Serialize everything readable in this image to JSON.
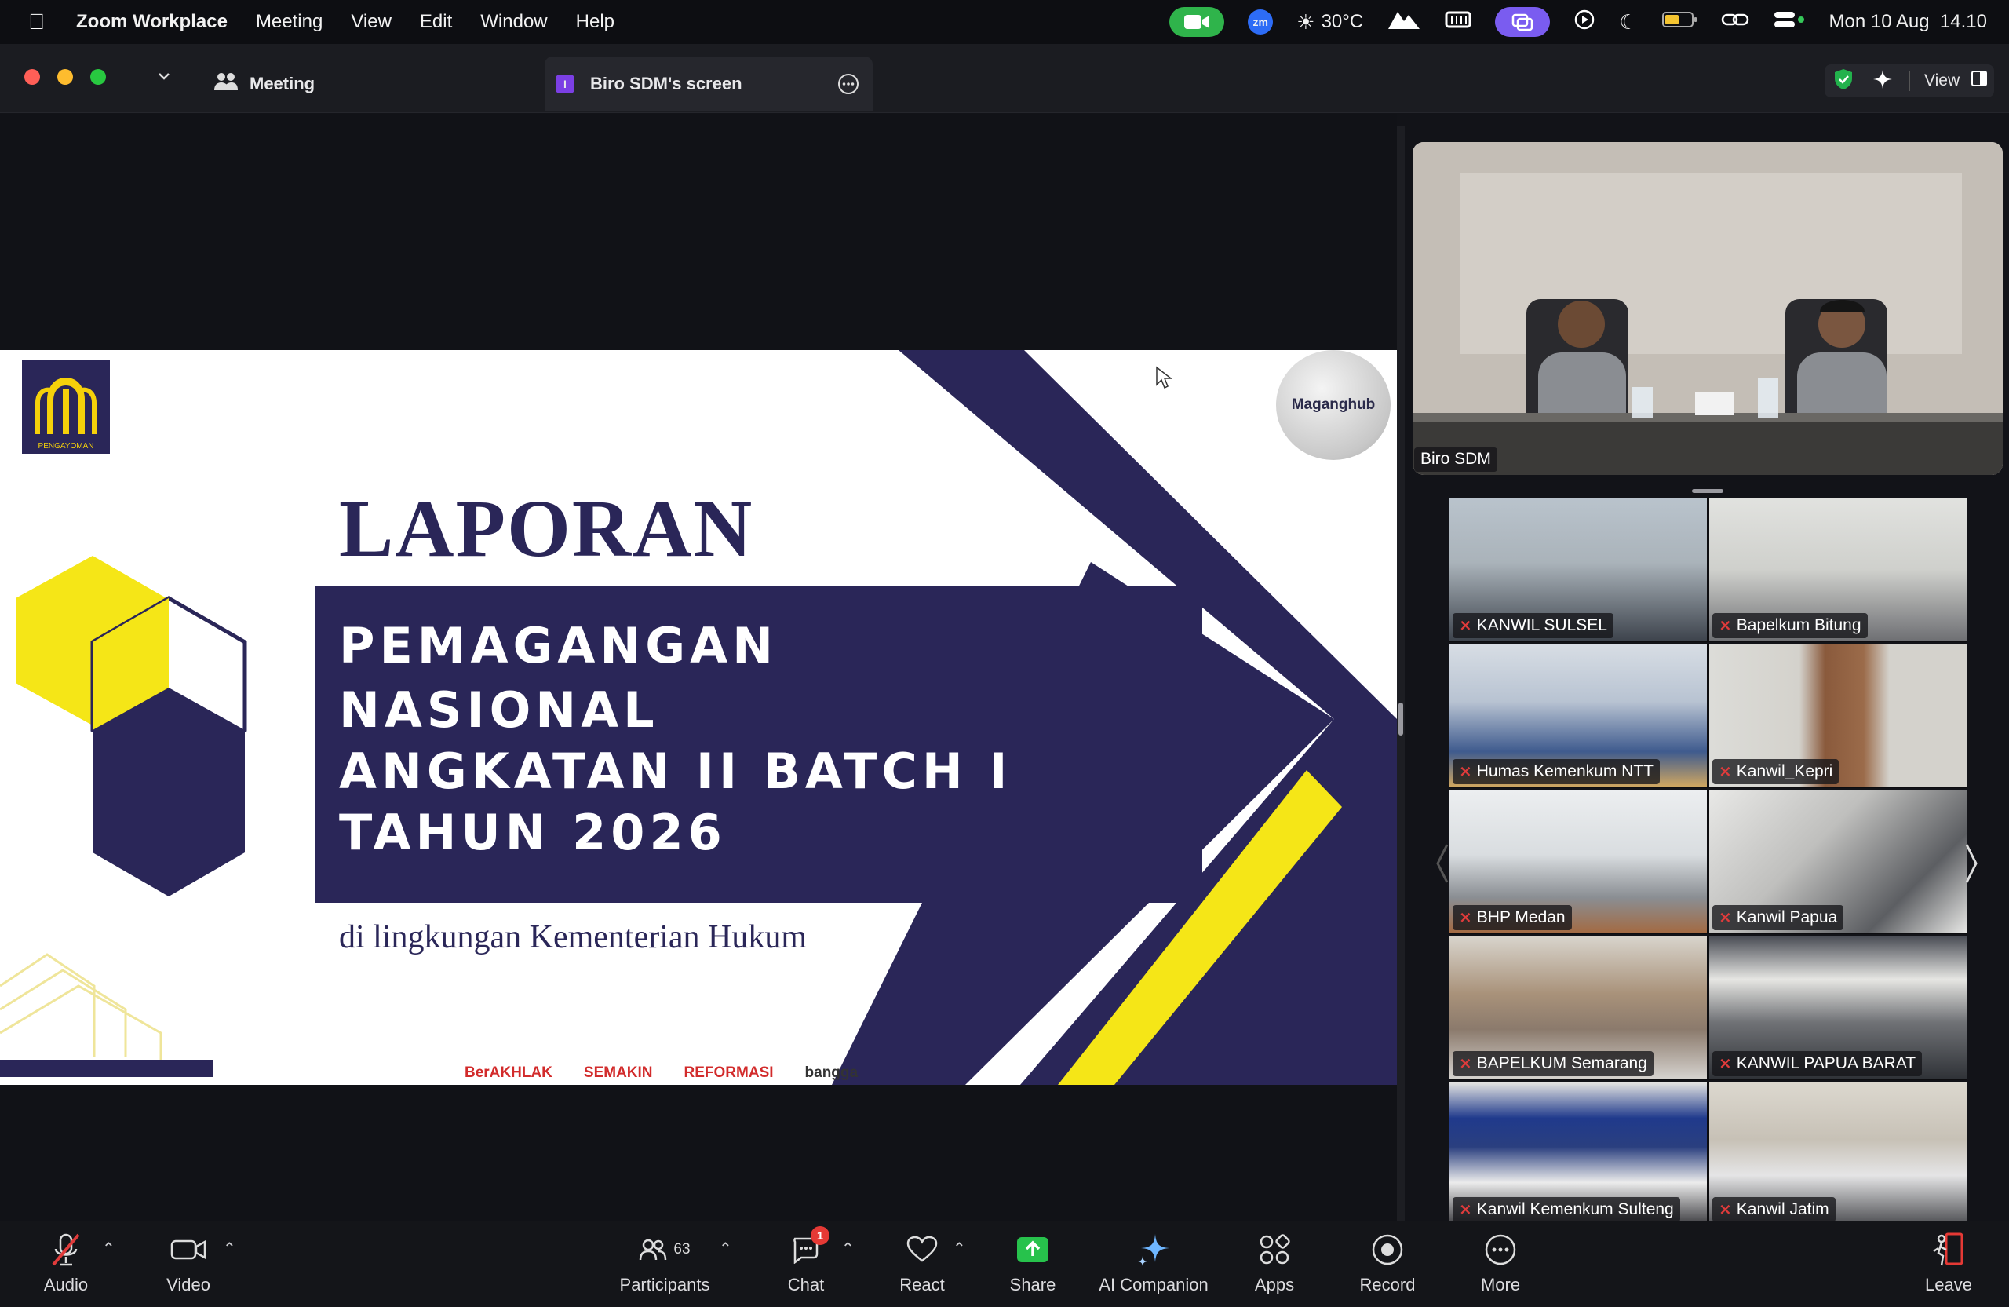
{
  "menubar": {
    "app_name": "Zoom Workplace",
    "menus": [
      "Meeting",
      "View",
      "Edit",
      "Window",
      "Help"
    ],
    "weather": "30°C",
    "datetime": "Mon 10 Aug  14.10",
    "zoom_badge": "zm"
  },
  "window": {
    "meeting_tab": "Meeting",
    "screen_tab": "Biro SDM's screen",
    "screen_tab_badge": "I",
    "view_label": "View"
  },
  "slide": {
    "title": "LAPORAN",
    "band_lines": [
      "PEMAGANGAN",
      "NASIONAL",
      "ANGKATAN II BATCH I",
      "TAHUN 2026"
    ],
    "subtitle": "di lingkungan Kementerian Hukum",
    "logo_caption": "PENGAYOMAN",
    "maganghub_logo": "Maganghub",
    "footer_logos": [
      "BerAKHLAK",
      "SEMAKIN",
      "REFORMASI",
      "bangga"
    ],
    "colors": {
      "navy": "#2a2658",
      "yellow": "#f5e617"
    }
  },
  "active_speaker": {
    "name": "Biro SDM"
  },
  "gallery": [
    {
      "name": "KANWIL SULSEL"
    },
    {
      "name": "Bapelkum Bitung"
    },
    {
      "name": "Humas Kemenkum NTT"
    },
    {
      "name": "Kanwil_Kepri"
    },
    {
      "name": "BHP Medan"
    },
    {
      "name": "Kanwil Papua"
    },
    {
      "name": "BAPELKUM Semarang"
    },
    {
      "name": "KANWIL PAPUA BARAT"
    },
    {
      "name": "Kanwil Kemenkum Sulteng"
    },
    {
      "name": "Kanwil Jatim"
    }
  ],
  "toolbar": {
    "audio": "Audio",
    "video": "Video",
    "participants": "Participants",
    "participants_count": "63",
    "chat": "Chat",
    "chat_badge": "1",
    "react": "React",
    "share": "Share",
    "ai_companion": "AI Companion",
    "apps": "Apps",
    "record": "Record",
    "more": "More",
    "leave": "Leave"
  }
}
